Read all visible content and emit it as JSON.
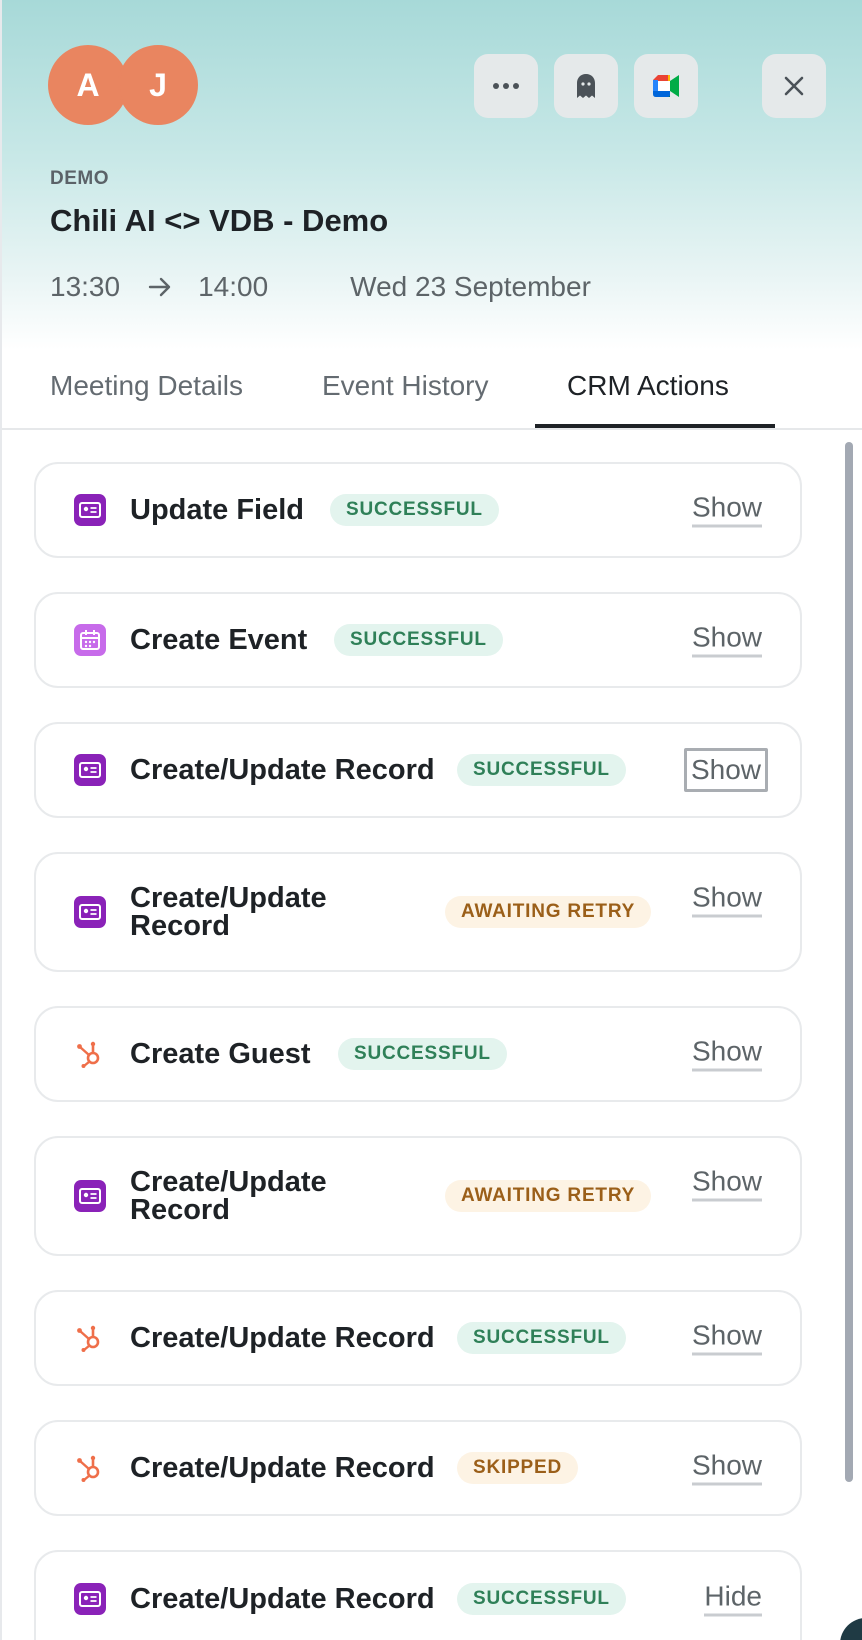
{
  "header": {
    "avatars": [
      {
        "initial": "A",
        "color": "#e98560"
      },
      {
        "initial": "J",
        "color": "#e98560"
      }
    ],
    "buttons": {
      "more_icon": "more-icon",
      "ghost_icon": "ghost-icon",
      "meet_icon": "google-meet-icon",
      "close_icon": "close-icon"
    },
    "kicker": "DEMO",
    "title": "Chili AI <> VDB - Demo",
    "time_start": "13:30",
    "time_end": "14:00",
    "date": "Wed 23 September"
  },
  "tabs": [
    {
      "label": "Meeting Details",
      "active": false
    },
    {
      "label": "Event History",
      "active": false
    },
    {
      "label": "CRM Actions",
      "active": true
    }
  ],
  "actions": [
    {
      "icon": "contact-card-icon",
      "label": "Update Field",
      "status": "SUCCESSFUL",
      "action": "Show"
    },
    {
      "icon": "calendar-icon",
      "label": "Create Event",
      "status": "SUCCESSFUL",
      "action": "Show"
    },
    {
      "icon": "contact-card-icon",
      "label": "Create/Update Record",
      "status": "SUCCESSFUL",
      "action": "Show"
    },
    {
      "icon": "contact-card-icon",
      "label": "Create/Update Record",
      "status": "AWAITING RETRY",
      "action": "Show"
    },
    {
      "icon": "hubspot-icon",
      "label": "Create Guest",
      "status": "SUCCESSFUL",
      "action": "Show"
    },
    {
      "icon": "contact-card-icon",
      "label": "Create/Update Record",
      "status": "AWAITING RETRY",
      "action": "Show"
    },
    {
      "icon": "hubspot-icon",
      "label": "Create/Update Record",
      "status": "SUCCESSFUL",
      "action": "Show"
    },
    {
      "icon": "hubspot-icon",
      "label": "Create/Update Record",
      "status": "SKIPPED",
      "action": "Show"
    },
    {
      "icon": "contact-card-icon",
      "label": "Create/Update Record",
      "status": "SUCCESSFUL",
      "action": "Hide"
    }
  ],
  "colors": {
    "accent": "#e98560",
    "success_bg": "#e3f4ee",
    "success_text": "#2f8058",
    "warning_bg": "#fdf3e4",
    "warning_text": "#9b5f19",
    "salesforce_purple": "#8a22b8",
    "hubspot_orange": "#ef6f4a"
  }
}
